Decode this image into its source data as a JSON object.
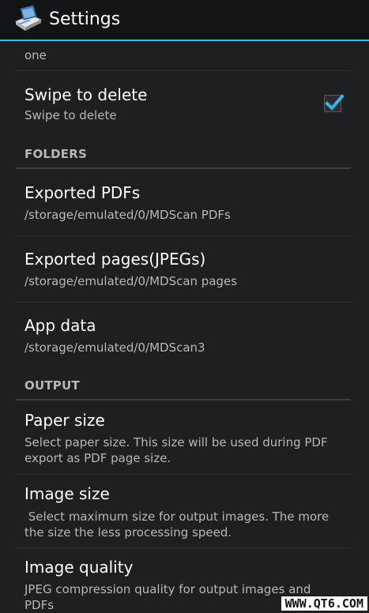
{
  "header": {
    "title": "Settings"
  },
  "items": {
    "partial_summary_tail": "one",
    "swipe": {
      "title": "Swipe to delete",
      "summary": "Swipe to delete",
      "checked": true
    },
    "folders_header": "FOLDERS",
    "exported_pdfs": {
      "title": "Exported PDFs",
      "summary": "/storage/emulated/0/MDScan PDFs"
    },
    "exported_pages": {
      "title": "Exported pages(JPEGs)",
      "summary": "/storage/emulated/0/MDScan pages"
    },
    "app_data": {
      "title": "App data",
      "summary": "/storage/emulated/0/MDScan3"
    },
    "output_header": "OUTPUT",
    "paper_size": {
      "title": "Paper size",
      "summary": "Select paper size. This size will be used during PDF export as PDF page size."
    },
    "image_size": {
      "title": "Image size",
      "summary": " Select maximum size for output images. The more the size the less processing speed."
    },
    "image_quality": {
      "title": "Image quality",
      "summary": "JPEG compression quality for output images and PDFs"
    }
  },
  "watermark": "WWW.QT6.COM",
  "colors": {
    "accent": "#33b5e5",
    "background": "#1e1f21",
    "action_bar": "#131416"
  }
}
